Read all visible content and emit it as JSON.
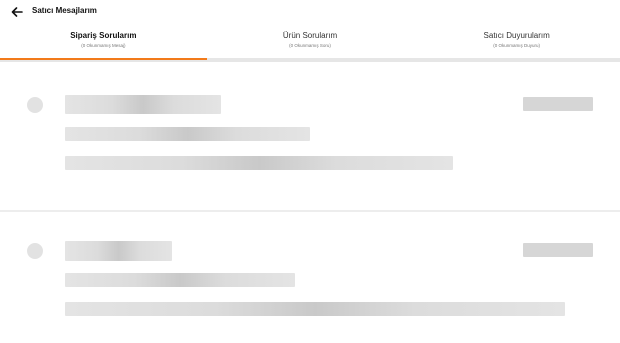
{
  "header": {
    "back_icon": "arrow-left-icon",
    "title": "Satıcı Mesajlarım"
  },
  "tabs": [
    {
      "label": "Sipariş Sorularım",
      "sublabel": "(0 Okunmamış Mesaj)",
      "active": true
    },
    {
      "label": "Ürün Sorularım",
      "sublabel": "(0 Okunmamış Soru)",
      "active": false
    },
    {
      "label": "Satıcı Duyurularım",
      "sublabel": "(0 Okunmamış Duyuru)",
      "active": false
    }
  ],
  "colors": {
    "accent": "#f27a1a",
    "skeleton": "#e0e0e0",
    "background": "#ffffff"
  },
  "state": "loading-skeleton"
}
